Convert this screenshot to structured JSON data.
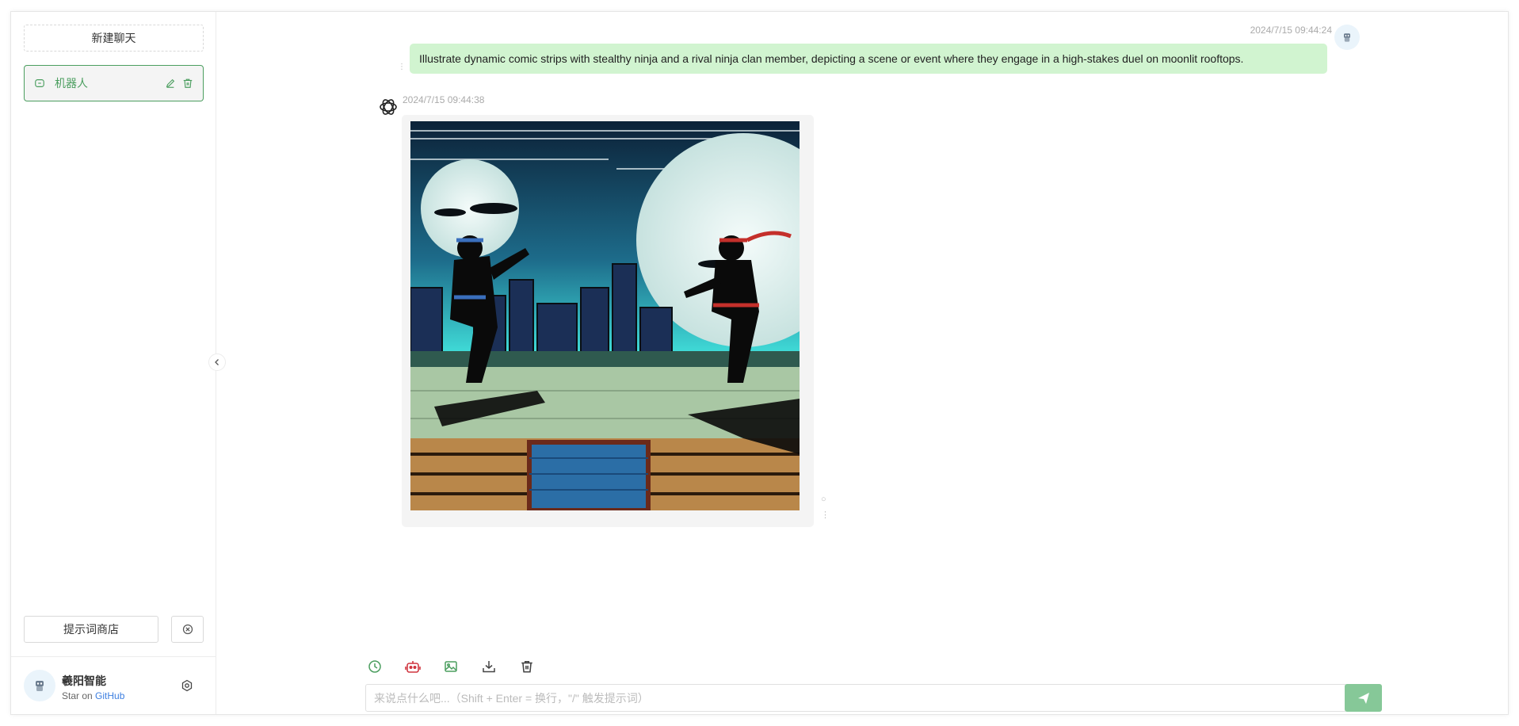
{
  "sidebar": {
    "new_chat_label": "新建聊天",
    "conversations": [
      {
        "label": "机器人"
      }
    ],
    "prompt_store_label": "提示词商店",
    "user": {
      "name": "羲阳智能",
      "sub_prefix": "Star on ",
      "sub_link": "GitHub"
    }
  },
  "chat": {
    "messages": [
      {
        "role": "user",
        "time": "2024/7/15 09:44:24",
        "text": "Illustrate dynamic comic strips with stealthy ninja and a rival ninja clan member, depicting a scene or event where they engage in a high-stakes duel on moonlit rooftops."
      },
      {
        "role": "assistant",
        "time": "2024/7/15 09:44:38",
        "image": "comic illustration of two ninjas dueling on a moonlit rooftop"
      }
    ]
  },
  "input": {
    "placeholder": "来说点什么吧...（Shift + Enter = 换行，\"/\" 触发提示词）",
    "value": ""
  },
  "colors": {
    "accent": "#4b9e5f",
    "user_bubble": "#d1f4d0",
    "send_button": "#86c898",
    "link": "#3d7fe0",
    "robot_icon": "#d0353f"
  },
  "icons": {
    "toolbar": [
      "history-icon",
      "robot-icon",
      "image-icon",
      "download-icon",
      "trash-icon"
    ]
  }
}
